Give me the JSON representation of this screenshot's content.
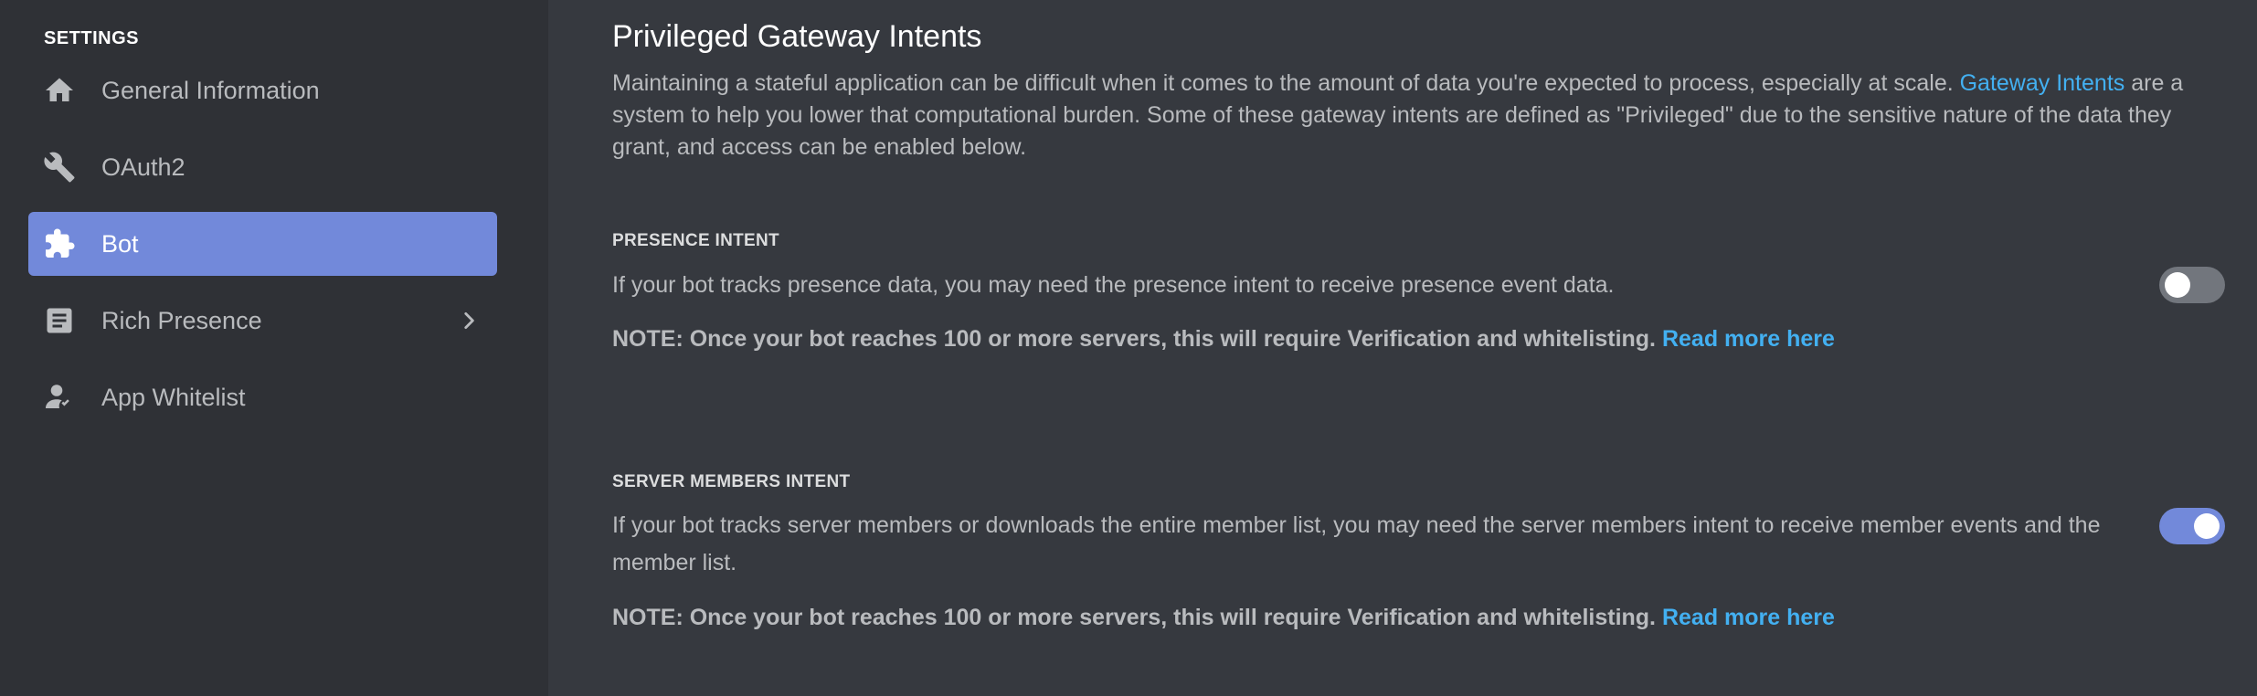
{
  "sidebar": {
    "heading": "SETTINGS",
    "items": [
      {
        "label": "General Information",
        "icon": "home-icon",
        "active": false
      },
      {
        "label": "OAuth2",
        "icon": "wrench-icon",
        "active": false
      },
      {
        "label": "Bot",
        "icon": "puzzle-piece-icon",
        "active": true
      },
      {
        "label": "Rich Presence",
        "icon": "document-icon",
        "active": false,
        "has_chevron": true
      },
      {
        "label": "App Whitelist",
        "icon": "person-add-icon",
        "active": false
      }
    ]
  },
  "main": {
    "title": "Privileged Gateway Intents",
    "description_before_link": "Maintaining a stateful application can be difficult when it comes to the amount of data you're expected to process, especially at scale. ",
    "description_link": "Gateway Intents",
    "description_after_link": " are a system to help you lower that computational burden. Some of these gateway intents are defined as \"Privileged\" due to the sensitive nature of the data they grant, and access can be enabled below.",
    "intents": [
      {
        "heading": "PRESENCE INTENT",
        "description": "If your bot tracks presence data, you may need the presence intent to receive presence event data.",
        "note": "NOTE: Once your bot reaches 100 or more servers, this will require Verification and whitelisting.",
        "note_link": "Read more here",
        "enabled": false
      },
      {
        "heading": "SERVER MEMBERS INTENT",
        "description": "If your bot tracks server members or downloads the entire member list, you may need the server members intent to receive member events and the member list.",
        "note": "NOTE: Once your bot reaches 100 or more servers, this will require Verification and whitelisting.",
        "note_link": "Read more here",
        "enabled": true
      }
    ]
  },
  "colors": {
    "sidebar_bg": "#2f3136",
    "main_bg": "#36393f",
    "accent": "#7289da",
    "link": "#43b0f1",
    "toggle_off": "#72767d"
  }
}
